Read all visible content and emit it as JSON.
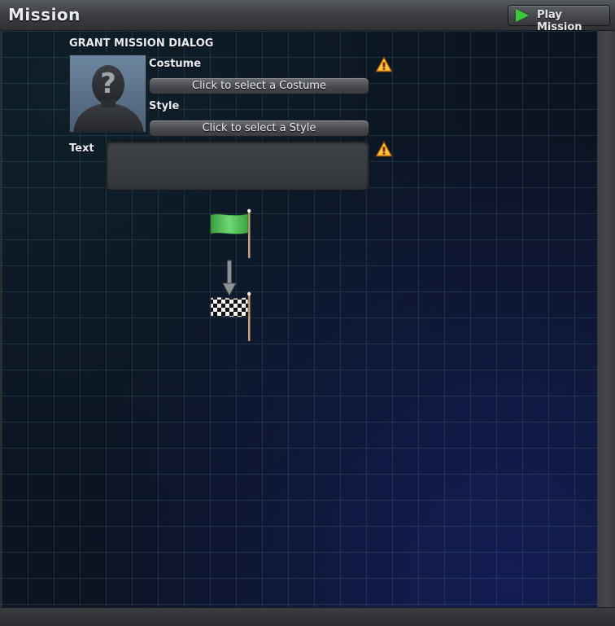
{
  "window": {
    "title": "Mission"
  },
  "toolbar": {
    "play_label": "Play Mission"
  },
  "dialog": {
    "title": "GRANT MISSION DIALOG",
    "costume_label": "Costume",
    "costume_button": "Click to select a Costume",
    "style_label": "Style",
    "style_button": "Click to select a Style",
    "text_label": "Text",
    "text_value": "",
    "portrait_glyph": "?"
  },
  "icons": {
    "warning": "warning-icon",
    "start": "green-flag-icon",
    "finish": "checkered-flag-icon",
    "arrow": "arrow-down-icon"
  },
  "colors": {
    "play_accent": "#3cc83c",
    "warning": "#f0a020",
    "start_flag": "#4cc050",
    "grid_bg": "#0c1322"
  }
}
